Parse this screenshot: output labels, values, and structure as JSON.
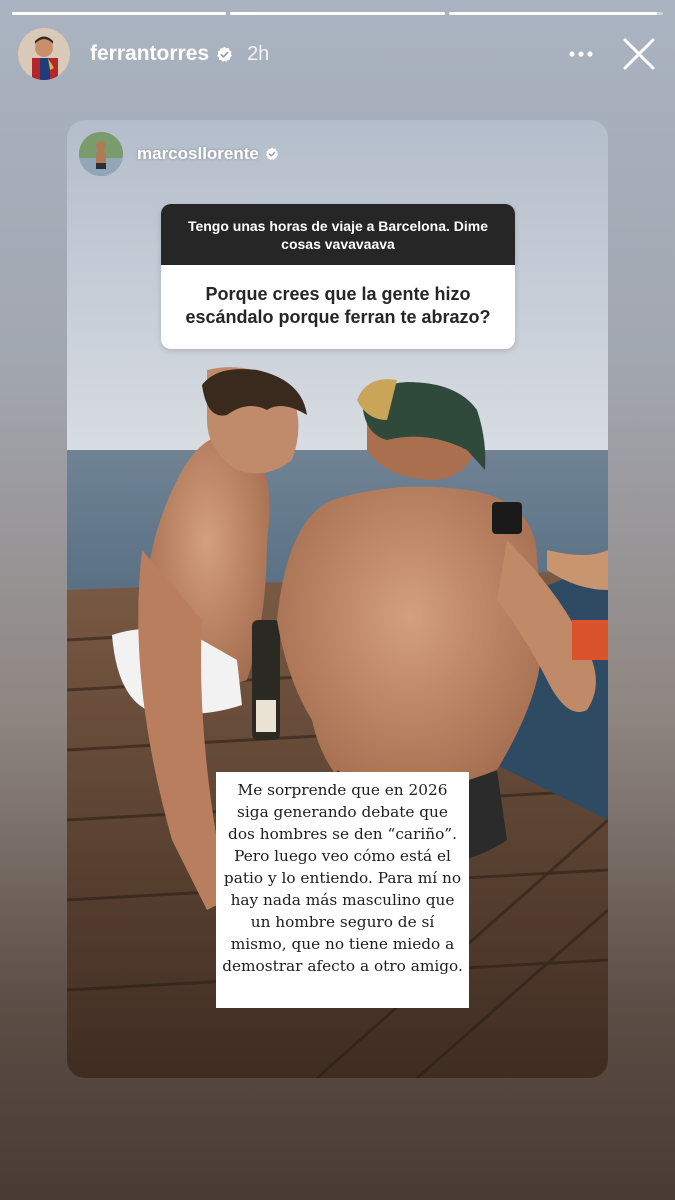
{
  "story": {
    "progress": [
      1,
      1,
      0.97
    ],
    "user": {
      "username": "ferrantorres",
      "time": "2h"
    },
    "icons": {
      "verified": "verified-badge-icon",
      "more": "more-options-icon",
      "close": "close-icon"
    }
  },
  "shared_post": {
    "username": "marcosllorente",
    "question_prompt": "Tengo unas horas de viaje a Barcelona. Dime cosas vavavaava",
    "question": "Porque crees que la gente hizo escándalo porque ferran te abrazo?",
    "answer": "Me sorprende que en 2026 siga generando debate que dos hombres se den “cariño”. Pero luego veo cómo está el patio y lo entiendo. Para mí no hay nada más masculino que un hombre seguro de sí mismo, que no tiene miedo a demostrar afecto a otro amigo."
  },
  "colors": {
    "question_header_bg": "#262626",
    "question_body_bg": "#ffffff",
    "text_light": "#ffffff"
  }
}
